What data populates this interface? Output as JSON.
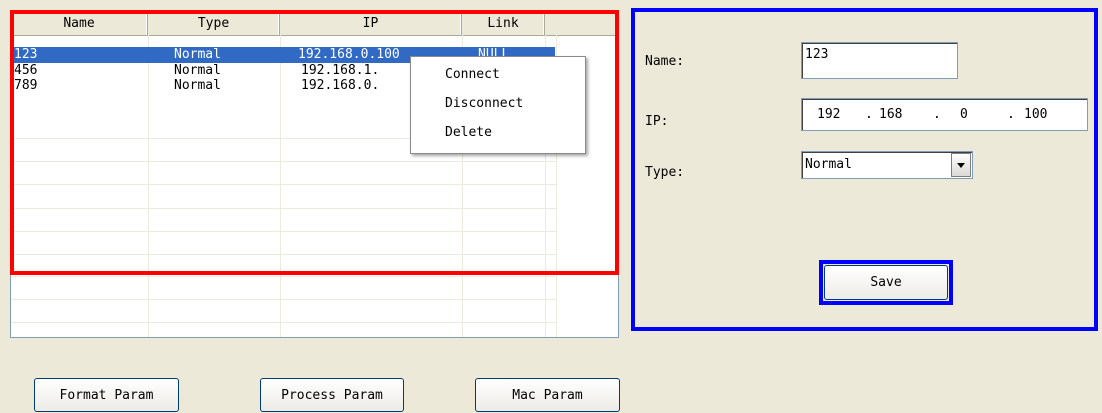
{
  "table": {
    "columns": [
      "Name",
      "Type",
      "IP",
      "Link"
    ],
    "rows": [
      {
        "name": "123",
        "type": "Normal",
        "ip": "192.168.0.100",
        "link": "NULL"
      },
      {
        "name": "456",
        "type": "Normal",
        "ip": "192.168.1.",
        "link": ""
      },
      {
        "name": "789",
        "type": "Normal",
        "ip": "192.168.0.",
        "link": ""
      }
    ]
  },
  "context_menu": [
    "Connect",
    "Disconnect",
    "Delete"
  ],
  "form": {
    "name_label": "Name:",
    "name_value": "123",
    "ip_label": "IP:",
    "ip_octets": [
      "192",
      "168",
      "0",
      "100"
    ],
    "ip_dot": ".",
    "type_label": "Type:",
    "type_value": "Normal",
    "save_label": "Save"
  },
  "buttons": {
    "format_param": "Format Param",
    "process_param": "Process Param",
    "mac_param": "Mac Param"
  },
  "colors": {
    "selection": "#316ac5",
    "highlight_red": "#ff0000",
    "highlight_blue": "#0000ff"
  }
}
